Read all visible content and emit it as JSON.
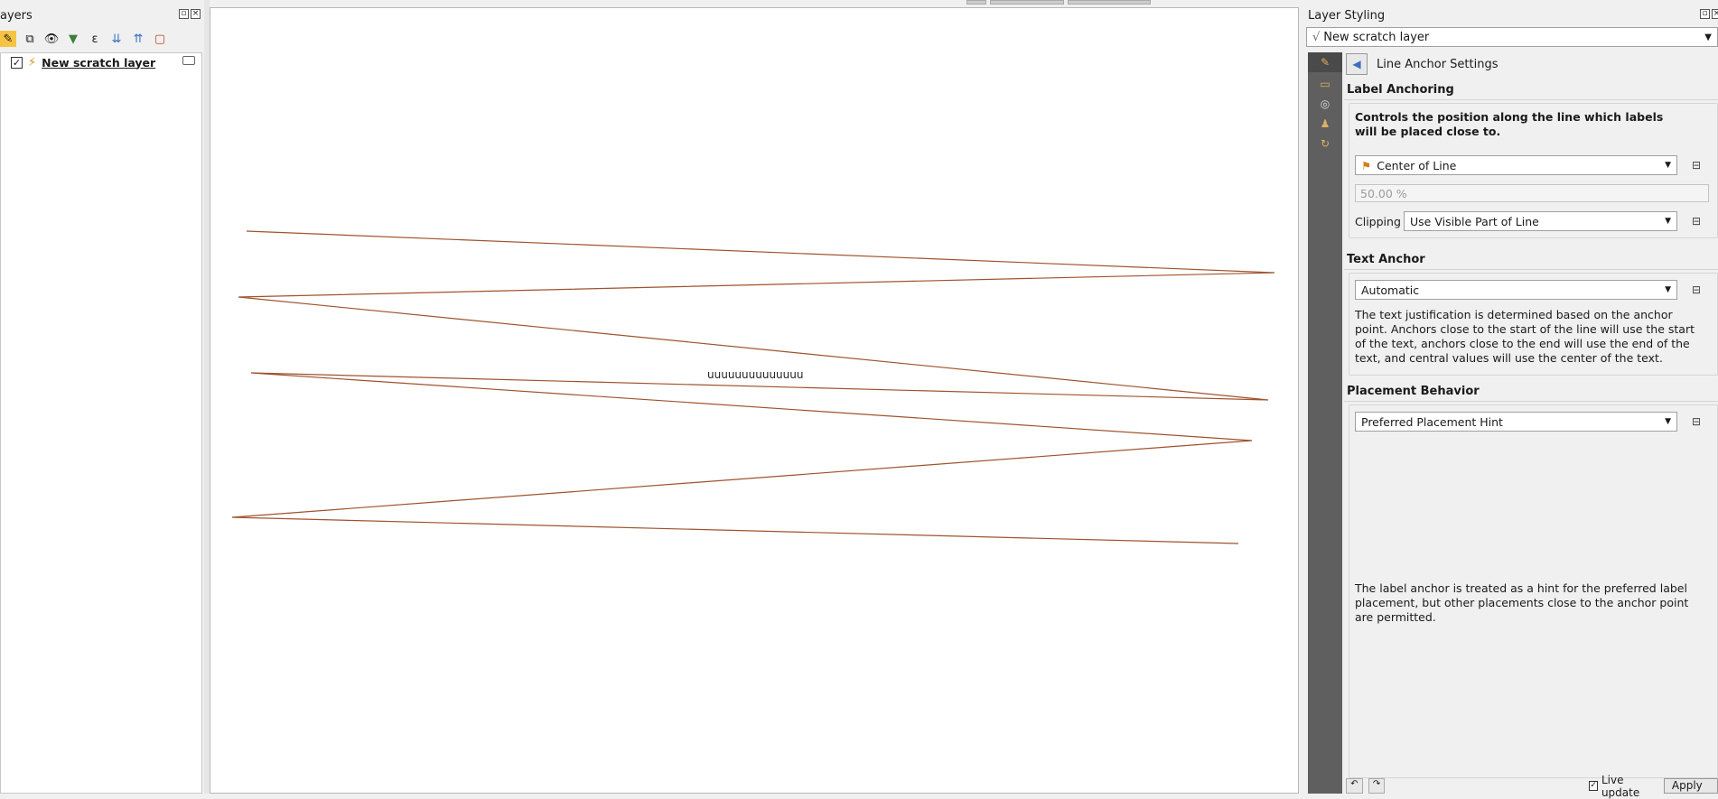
{
  "layers_panel": {
    "title": "ayers",
    "layer_name": "New scratch layer",
    "checked": true
  },
  "map": {
    "label_text": "uuuuuuuuuuuuuu"
  },
  "styling_panel": {
    "title": "Layer Styling",
    "layer_combo": "New scratch layer",
    "back_title": "Line Anchor Settings",
    "label_anchoring": {
      "header": "Label Anchoring",
      "description": "Controls the position along the line which labels will be placed close to.",
      "position_combo": "Center of Line",
      "percent_value": "50.00 %",
      "clipping_label": "Clipping",
      "clipping_combo": "Use Visible Part of Line"
    },
    "text_anchor": {
      "header": "Text Anchor",
      "combo": "Automatic",
      "description": "The text justification is determined based on the anchor point. Anchors close to the start of the line will use the start of the text, anchors close to the end will use the end of the text, and central values will use the center of the text."
    },
    "placement_behavior": {
      "header": "Placement Behavior",
      "combo": "Preferred Placement Hint",
      "description": "The label anchor is treated as a hint for the preferred label placement, but other placements close to the anchor point are permitted."
    },
    "bottom": {
      "live_update": "Live update",
      "apply": "Apply"
    }
  },
  "colors": {
    "line": "#a0522d",
    "side_tab_bg": "#5f5f5f"
  },
  "icons": [
    "paint-brush-icon",
    "filter-icon",
    "expression-icon",
    "back-arrow-icon",
    "data-defined-icon"
  ]
}
